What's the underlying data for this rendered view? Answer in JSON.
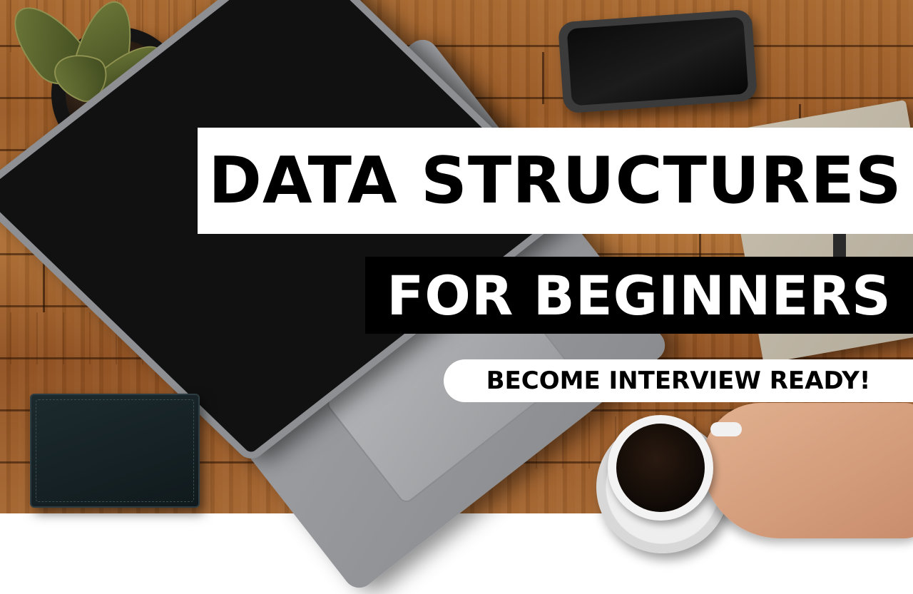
{
  "thumbnail": {
    "title": "DATA STRUCTURES",
    "subtitle": "FOR BEGINNERS",
    "tagline": "BECOME INTERVIEW READY!"
  },
  "colors": {
    "banner_light": "#ffffff",
    "banner_dark": "#000000",
    "text_dark": "#000000",
    "text_light": "#ffffff",
    "wood": "#a56630"
  },
  "scene_objects": [
    "plant-icon",
    "laptop-icon",
    "phone-icon",
    "notebook-icon",
    "wallet-icon",
    "coffee-cup-icon",
    "hand-icon"
  ]
}
